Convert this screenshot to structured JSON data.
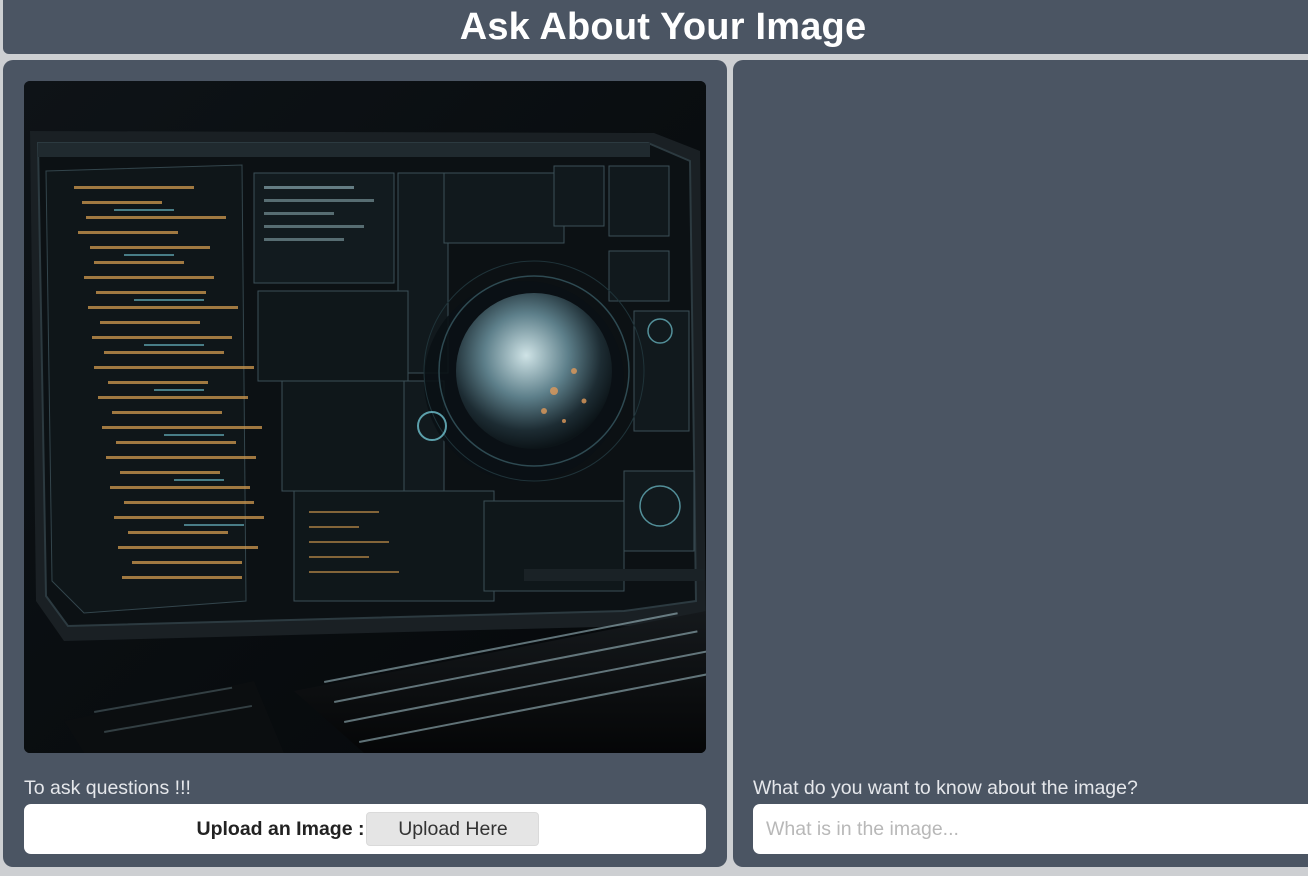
{
  "header": {
    "title": "Ask About Your Image"
  },
  "left_panel": {
    "image_alt": "futuristic computer monitor with code and planet",
    "caption": "To ask questions !!!",
    "upload_label": "Upload an Image :",
    "upload_button": "Upload Here"
  },
  "right_panel": {
    "prompt_label": "What do you want to know about the image?",
    "input_value": "",
    "input_placeholder": "What is in the image..."
  },
  "colors": {
    "panel_bg": "#4b5563",
    "page_bg": "#cdcfd2",
    "text_light": "#e5e7eb"
  }
}
